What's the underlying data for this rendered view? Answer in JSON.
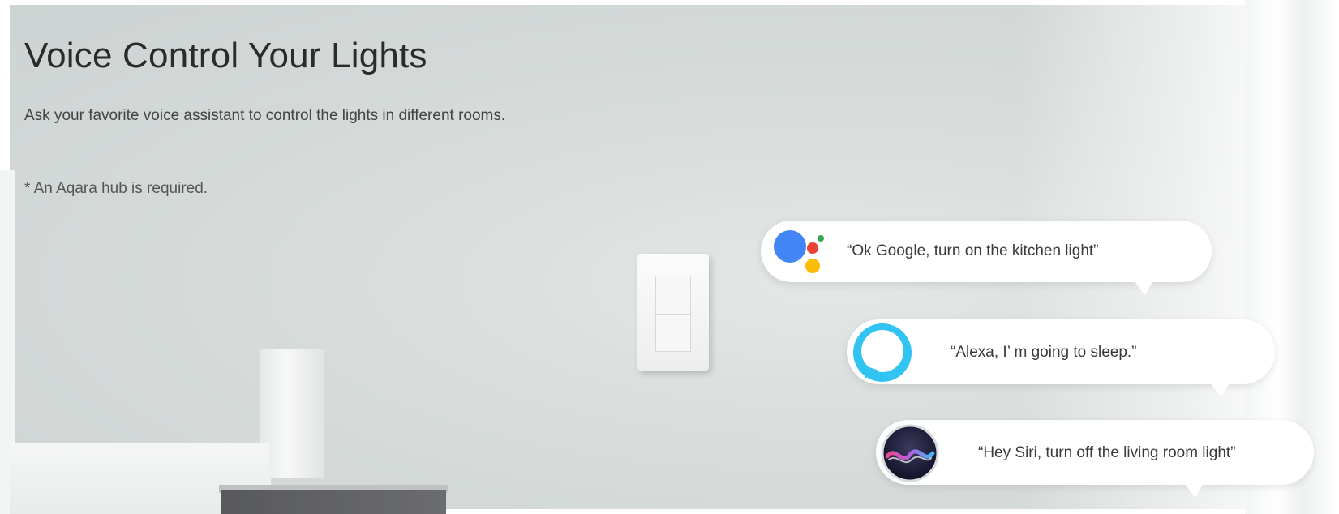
{
  "header": {
    "title": "Voice Control Your Lights",
    "subtitle": "Ask your favorite voice assistant to control the lights in different rooms.",
    "note": "* An Aqara hub is required."
  },
  "assistants": [
    {
      "icon": "google-assistant-icon",
      "quote": "“Ok Google, turn on the kitchen light”"
    },
    {
      "icon": "alexa-icon",
      "quote": "“Alexa, I’ m going to sleep.”"
    },
    {
      "icon": "siri-icon",
      "quote": "“Hey Siri, turn off the living room light”"
    }
  ],
  "colors": {
    "google_blue": "#4285F4",
    "google_red": "#EA4335",
    "google_yellow": "#FBBC05",
    "google_green": "#34A853",
    "alexa_cyan": "#31C4F3"
  }
}
